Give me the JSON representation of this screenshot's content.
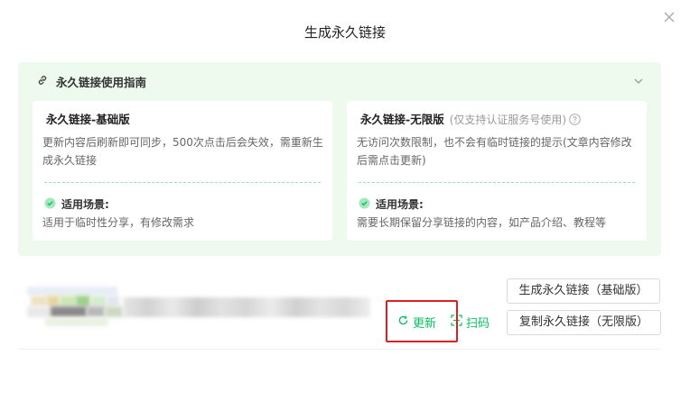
{
  "dialog": {
    "title": "生成永久链接",
    "close_icon": "close-icon"
  },
  "guide": {
    "title": "永久链接使用指南",
    "link_icon": "link-icon",
    "toggle_icon": "chevron-down-icon",
    "cards": [
      {
        "title": "永久链接-基础版",
        "tag": "",
        "description": "更新内容后刷新即可同步，500次点击后会失效，需重新生成永久链接",
        "scene_label": "适用场景:",
        "scene_text": "适用于临时性分享，有修改需求"
      },
      {
        "title": "永久链接-无限版",
        "tag": "(仅支持认证服务号使用)",
        "description": "无访问次数限制，也不会有临时链接的提示(文章内容修改后需点击更新)",
        "scene_label": "适用场景:",
        "scene_text": "需要长期保留分享链接的内容，如产品介绍、教程等"
      }
    ]
  },
  "link_row": {
    "update_label": "更新",
    "scan_label": "扫码",
    "basic_button": "生成永久链接（基础版）",
    "unlimited_button": "复制永久链接（无限版）"
  },
  "colors": {
    "accent": "#07c160",
    "panel_bg": "#eefaed",
    "highlight": "#e02020"
  }
}
